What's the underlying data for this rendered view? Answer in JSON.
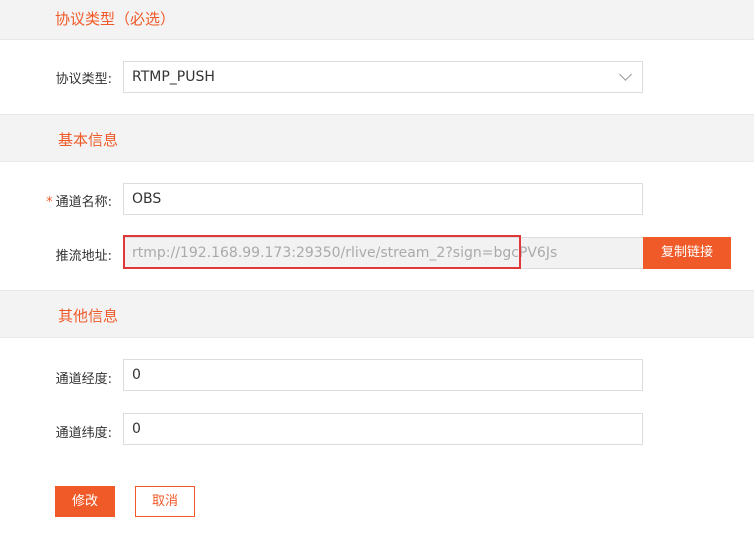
{
  "sections": {
    "protocol": {
      "title": "协议类型（必选）"
    },
    "basic": {
      "title": "基本信息"
    },
    "other": {
      "title": "其他信息"
    }
  },
  "form": {
    "protocol_type": {
      "label": "协议类型:",
      "value": "RTMP_PUSH"
    },
    "channel_name": {
      "label": "通道名称:",
      "required_mark": "*",
      "value": "OBS"
    },
    "push_url": {
      "label": "推流地址:",
      "value": "rtmp://192.168.99.173:29350/rlive/stream_2?sign=bgcPV6Js",
      "copy_label": "复制链接"
    },
    "longitude": {
      "label": "通道经度:",
      "value": "0"
    },
    "latitude": {
      "label": "通道纬度:",
      "value": "0"
    }
  },
  "actions": {
    "submit_label": "修改",
    "cancel_label": "取消"
  },
  "colors": {
    "accent": "#f05a28",
    "highlight": "#e0373a"
  }
}
